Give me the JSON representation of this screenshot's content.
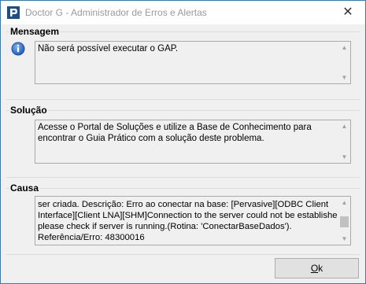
{
  "window": {
    "title": "Doctor G - Administrador de Erros e Alertas",
    "close_glyph": "✕",
    "app_icon": "app-logo-icon"
  },
  "mensagem": {
    "label": "Mensagem",
    "icon": "info-icon",
    "text": "Não será possível executar o GAP."
  },
  "solucao": {
    "label": "Solução",
    "text": "Acesse o Portal de Soluções e utilize a Base de Conhecimento para encontrar o Guia Prático com a solução deste problema."
  },
  "causa": {
    "label": "Causa",
    "lines": [
      "ser criada. Descrição: Erro ao conectar na base: [Pervasive][ODBC Client",
      "Interface][Client LNA][SHM]Connection to the server could not be established,",
      "please check if server is running.(Rotina: 'ConectarBaseDados').",
      "Referência/Erro: 48300016"
    ]
  },
  "buttons": {
    "ok_label_first": "O",
    "ok_label_rest": "k"
  },
  "colors": {
    "window_border": "#1883d7",
    "info_blue": "#2a6cc4"
  }
}
